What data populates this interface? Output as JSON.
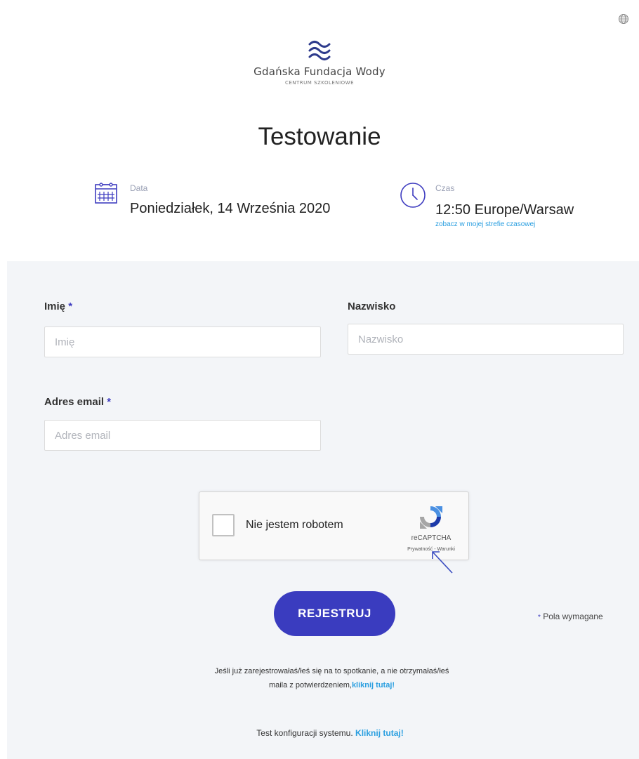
{
  "header": {
    "language_icon": "globe-icon"
  },
  "logo": {
    "icon": "waves-icon",
    "name": "Gdańska Fundacja Wody",
    "subtitle": "CENTRUM SZKOLENIOWE"
  },
  "event": {
    "title": "Testowanie",
    "date_label": "Data",
    "date_value": "Poniedziałek, 14 Września 2020",
    "date_icon": "calendar-icon",
    "time_label": "Czas",
    "time_value": "12:50 Europe/Warsaw",
    "time_icon": "clock-icon",
    "timezone_link": "zobacz w mojej strefie czasowej"
  },
  "form": {
    "first_name_label": "Imię",
    "first_name_placeholder": "Imię",
    "last_name_label": "Nazwisko",
    "last_name_placeholder": "Nazwisko",
    "email_label": "Adres email",
    "email_placeholder": "Adres email",
    "required_mark": "*",
    "recaptcha": {
      "label": "Nie jestem robotem",
      "brand": "reCAPTCHA",
      "terms": "Prywatność - Warunki",
      "icon": "recaptcha-icon"
    },
    "submit_label": "REJESTRUJ",
    "required_note": "Pola wymagane",
    "info_text": "Jeśli już zarejestrowałaś/łeś się na to spotkanie, a nie otrzymałaś/łeś maila z potwierdzeniem,",
    "info_link": "kliknij tutaj!",
    "syscheck_text": "Test konfiguracji systemu.",
    "syscheck_link": "Kliknij tutaj!"
  },
  "colors": {
    "accent": "#3a3cbf",
    "link": "#2b9fe0",
    "form_background": "#f3f5f8"
  }
}
